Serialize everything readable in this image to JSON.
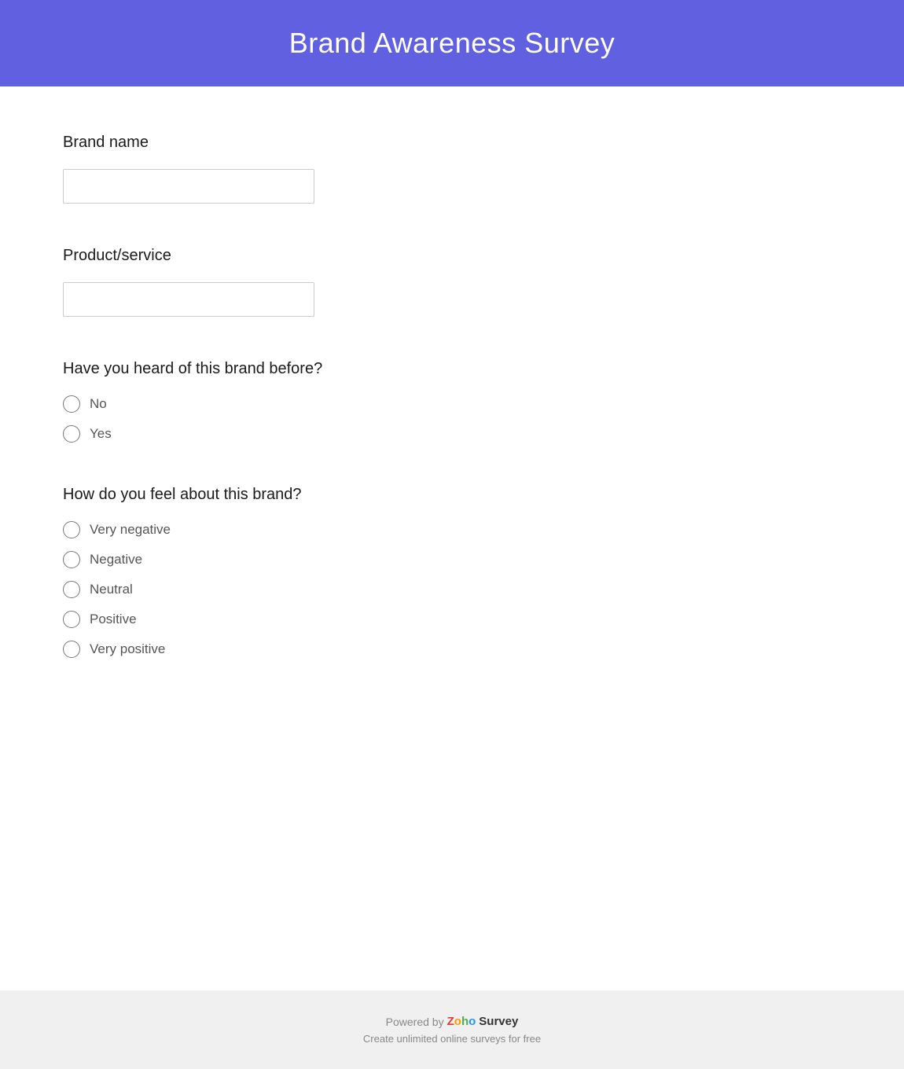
{
  "header": {
    "title": "Brand Awareness Survey",
    "bg_color": "#6060e0"
  },
  "questions": [
    {
      "id": "brand-name",
      "label": "Brand name",
      "type": "text",
      "placeholder": ""
    },
    {
      "id": "product-service",
      "label": "Product/service",
      "type": "text",
      "placeholder": ""
    },
    {
      "id": "heard-before",
      "label": "Have you heard of this brand before?",
      "type": "radio",
      "options": [
        "No",
        "Yes"
      ]
    },
    {
      "id": "brand-feeling",
      "label": "How do you feel about this brand?",
      "type": "radio",
      "options": [
        "Very negative",
        "Negative",
        "Neutral",
        "Positive",
        "Very positive"
      ]
    }
  ],
  "footer": {
    "powered_by": "Powered by",
    "zoho_letters": [
      "Z",
      "o",
      "h",
      "o"
    ],
    "zoho_colors": [
      "#e53935",
      "#ff9800",
      "#4caf50",
      "#2196f3"
    ],
    "survey_label": "Survey",
    "tagline": "Create unlimited online surveys for free"
  }
}
